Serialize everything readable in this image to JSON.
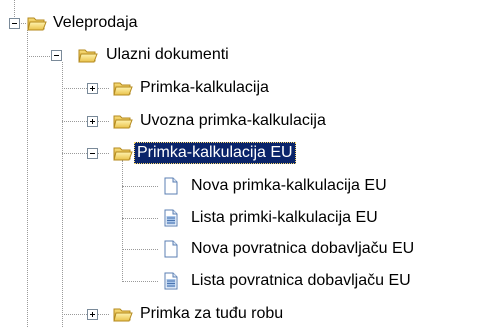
{
  "tree": {
    "root_label": "Veleprodaja",
    "ulazni_label": "Ulazni dokumenti",
    "items": {
      "primka_kalkulacija": "Primka-kalkulacija",
      "uvozna_primka": "Uvozna primka-kalkulacija",
      "primka_eu": "Primka-kalkulacija EU",
      "primka_tudu": "Primka za tuđu robu"
    },
    "eu_children": {
      "nova_primka": "Nova primka-kalkulacija EU",
      "lista_primki": "Lista primki-kalkulacija EU",
      "nova_povratnica": "Nova povratnica dobavljaču EU",
      "lista_povratnica": "Lista povratnica dobavljaču EU"
    },
    "selected": "Primka-kalkulacija EU"
  }
}
